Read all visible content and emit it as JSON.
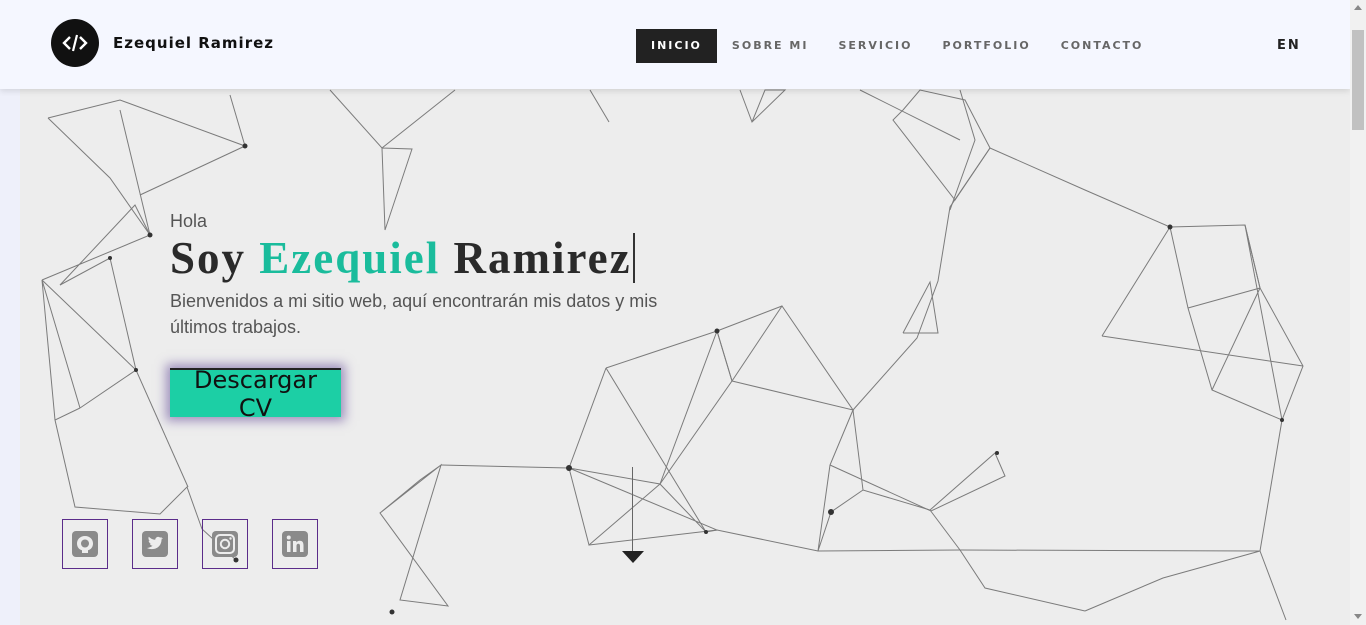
{
  "header": {
    "brand": "Ezequiel Ramirez",
    "logo_icon": "code-icon",
    "nav": [
      {
        "label": "INICIO",
        "active": true
      },
      {
        "label": "SOBRE MI",
        "active": false
      },
      {
        "label": "SERVICIO",
        "active": false
      },
      {
        "label": "PORTFOLIO",
        "active": false
      },
      {
        "label": "CONTACTO",
        "active": false
      }
    ],
    "language": "EN"
  },
  "hero": {
    "greeting": "Hola",
    "headline_prefix": "Soy ",
    "headline_highlight": "Ezequiel",
    "headline_suffix": " Ramirez",
    "intro": "Bienvenidos a mi sitio web, aquí encontrarán mis datos y mis últimos trabajos.",
    "cta_label": "Descargar CV",
    "social": [
      {
        "icon": "github-icon"
      },
      {
        "icon": "twitter-icon"
      },
      {
        "icon": "instagram-icon"
      },
      {
        "icon": "linkedin-icon"
      }
    ],
    "scroll_icon": "arrow-down-icon"
  },
  "colors": {
    "accent": "#1abc9c",
    "button": "#1ccfa5",
    "nav_active_bg": "#222222",
    "hero_bg": "#ededed",
    "header_bg": "#f5f7ff",
    "social_border": "#5b2c8a"
  }
}
